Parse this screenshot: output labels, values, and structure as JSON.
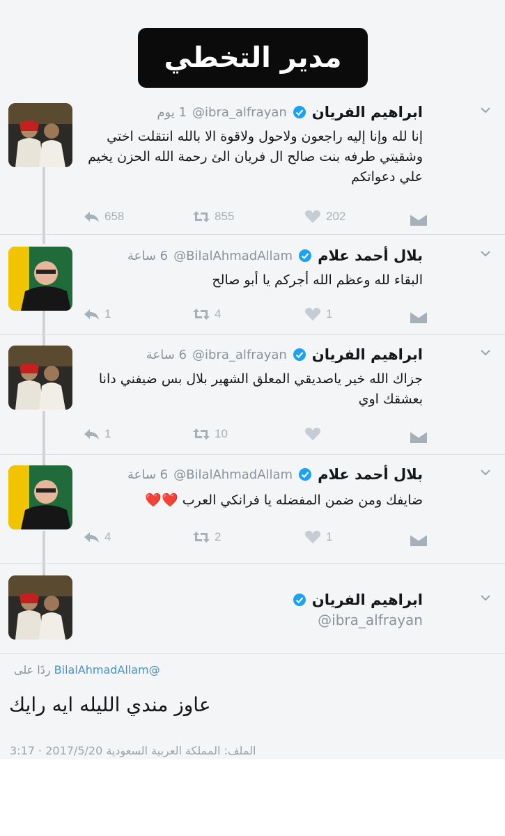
{
  "banner": {
    "title": "مدير التخطي"
  },
  "tweets": [
    {
      "name": "ابراهيم الفريان",
      "handle": "@ibra_alfrayan",
      "time": "1 يوم",
      "text": [
        "إنا لله وإنا إليه راجعون  ولاحول ولاقوة الا بالله انتقلت اختي",
        "وشقيتي طرفه بنت صالح ال فريان الئ رحمة الله الحزن يخيم",
        "علي دعواتكم"
      ],
      "reply_count": "658",
      "retweet_count": "855",
      "like_count": "202"
    },
    {
      "name": "بلال أحمد علام",
      "handle": "@BilalAhmadAllam",
      "time": "6 ساعة",
      "text": [
        "البقاء لله وعظم الله أجركم يا أبو صالح"
      ],
      "reply_count": "1",
      "retweet_count": "4",
      "like_count": "1"
    },
    {
      "name": "ابراهيم الفريان",
      "handle": "@ibra_alfrayan",
      "time": "6 ساعة",
      "text": [
        "جزاك الله خير ياصديقي المعلق الشهير بلال بس ضيفني  دانا",
        "بعشقك اوي"
      ],
      "reply_count": "1",
      "retweet_count": "10",
      "like_count": ""
    },
    {
      "name": "بلال أحمد علام",
      "handle": "@BilalAhmadAllam",
      "time": "6 ساعة",
      "text": [
        "ضايفك ومن ضمن المفضله يا فرانكي العرب ❤️❤️"
      ],
      "reply_count": "4",
      "retweet_count": "2",
      "like_count": "1"
    }
  ],
  "focused": {
    "name": "ابراهيم الفريان",
    "handle": "@ibra_alfrayan",
    "reply_prefix": "ردًا على",
    "reply_to": "@BilalAhmadAllam",
    "text": "عاوز مندي الليله ايه رايك",
    "meta": "الملف: المملكة العربية السعودية  2017/5/20 · 3:17"
  },
  "colors": {
    "verified": "#1da1f2",
    "icon_gray": "#a7b0b8",
    "like": "#c5ccd3"
  }
}
